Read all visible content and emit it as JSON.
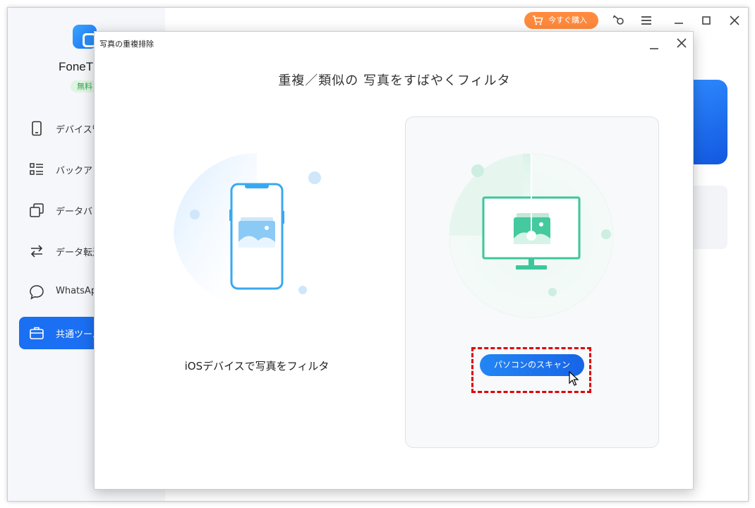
{
  "app": {
    "name": "FoneT",
    "badge": "無料",
    "buy_label": "今すぐ購入"
  },
  "sidebar": {
    "items": [
      {
        "label": "デバイス管",
        "icon": "phone-icon",
        "active": false
      },
      {
        "label": "バックアッ",
        "icon": "list-icon",
        "active": false
      },
      {
        "label": "データバッ",
        "icon": "copy-icon",
        "active": false
      },
      {
        "label": "データ転送",
        "icon": "transfer-icon",
        "active": false
      },
      {
        "label": "WhatsApp",
        "icon": "chat-bubble-icon",
        "active": false
      },
      {
        "label": "共通ツール",
        "icon": "toolbox-icon",
        "active": true
      }
    ]
  },
  "dialog": {
    "title": "写真の重複排除",
    "heading": "重複／類似の 写真をすばやくフィルタ",
    "left_label": "iOSデバイスで写真をフィルタ",
    "scan_button": "パソコンのスキャン"
  },
  "colors": {
    "accent": "#1b6ff2",
    "buy": "#ff8a3d",
    "monitor": "#3cc79a",
    "phone": "#38a9f0",
    "highlight_frame": "#e00000"
  }
}
